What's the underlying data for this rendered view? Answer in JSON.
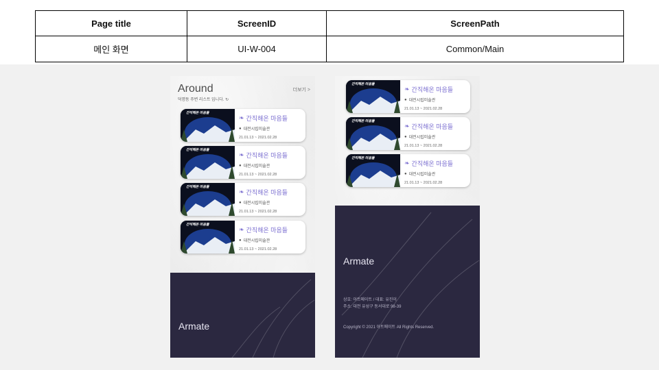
{
  "spec": {
    "headers": [
      "Page title",
      "ScreenID",
      "ScreenPath"
    ],
    "values": [
      "메인 화면",
      "UI-W-004",
      "Common/Main"
    ]
  },
  "left_screen": {
    "section_title": "Around",
    "section_subtitle": "덕명동 주변 리스트 입니다.",
    "more_link": "더보기 >",
    "cards": [
      {
        "thumb_title": "간직해온 마음들",
        "title": "간직해온 마음들",
        "place": "대전시립미술관",
        "dates": "21.01.13 ~ 2021.02.28"
      },
      {
        "thumb_title": "간직해온 마음들",
        "title": "간직해온 마음들",
        "place": "대전시립미술관",
        "dates": "21.01.13 ~ 2021.02.28"
      },
      {
        "thumb_title": "간직해온 마음들",
        "title": "간직해온 마음들",
        "place": "대전시립미술관",
        "dates": "21.01.13 ~ 2021.02.28"
      },
      {
        "thumb_title": "간직해온 마음들",
        "title": "간직해온 마음들",
        "place": "대전시립미술관",
        "dates": "21.01.13 ~ 2021.02.28"
      }
    ],
    "footer_brand": "Armate"
  },
  "right_screen": {
    "cards": [
      {
        "thumb_title": "간직해온 마음들",
        "title": "간직해온 마음들",
        "place": "대전시립미술관",
        "dates": "21.01.13 ~ 2021.02.28"
      },
      {
        "thumb_title": "간직해온 마음들",
        "title": "간직해온 마음들",
        "place": "대전시립미술관",
        "dates": "21.01.13 ~ 2021.02.28"
      },
      {
        "thumb_title": "간직해온 마음들",
        "title": "간직해온 마음들",
        "place": "대전시립미술관",
        "dates": "21.01.13 ~ 2021.02.28"
      }
    ],
    "footer_brand": "Armate",
    "footer_company": "상호: 아트메이트 / 대표: 유진이",
    "footer_address": "주소: 대전 유성구 동서대로 98-39",
    "footer_copyright": "Copyright © 2021 아트메이트 All Rights Reserved."
  },
  "colors": {
    "accent": "#7b6fd0",
    "footer_bg": "#2b2840",
    "canvas_bg": "#f1f1f1"
  },
  "icons": {
    "title_icon": "leaf-icon",
    "place_icon": "location-pin-icon",
    "subtitle_icon": "refresh-icon"
  }
}
